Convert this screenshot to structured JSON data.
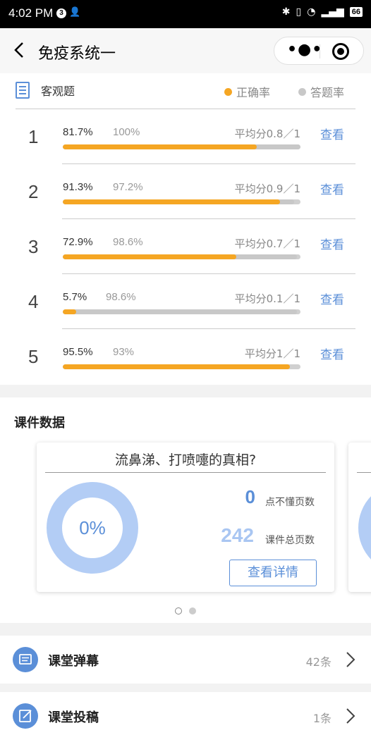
{
  "status_bar": {
    "time": "4:02 PM",
    "badge": "3",
    "battery": "66"
  },
  "nav": {
    "title": "免疫系统一"
  },
  "objective": {
    "title": "客观题",
    "legend": [
      {
        "label": "正确率",
        "color": "#f5a623"
      },
      {
        "label": "答题率",
        "color": "#c8c8c8"
      }
    ],
    "view_label": "查看",
    "questions": [
      {
        "num": "1",
        "correct": "81.7%",
        "rate": "100%",
        "avg": "平均分0.8／1",
        "correct_value": 81.7,
        "rate_value": 100
      },
      {
        "num": "2",
        "correct": "91.3%",
        "rate": "97.2%",
        "avg": "平均分0.9／1",
        "correct_value": 91.3,
        "rate_value": 97.2
      },
      {
        "num": "3",
        "correct": "72.9%",
        "rate": "98.6%",
        "avg": "平均分0.7／1",
        "correct_value": 72.9,
        "rate_value": 98.6
      },
      {
        "num": "4",
        "correct": "5.7%",
        "rate": "98.6%",
        "avg": "平均分0.1／1",
        "correct_value": 5.7,
        "rate_value": 98.6
      },
      {
        "num": "5",
        "correct": "95.5%",
        "rate": "93%",
        "avg": "平均分1／1",
        "correct_value": 95.5,
        "rate_value": 93
      }
    ]
  },
  "courseware": {
    "section_title": "课件数据",
    "card": {
      "title": "流鼻涕、打喷嚏的真相?",
      "percent": "0%",
      "confused_pages": "0",
      "confused_label": "点不懂页数",
      "total_pages": "242",
      "total_label": "课件总页数",
      "detail_button": "查看详情"
    },
    "pager": {
      "count": 2,
      "active": 0
    }
  },
  "list": [
    {
      "label": "课堂弹幕",
      "count": "42条",
      "icon": "barrage-icon"
    },
    {
      "label": "课堂投稿",
      "count": "1条",
      "icon": "submission-icon"
    }
  ],
  "colors": {
    "accent": "#5b8fd8",
    "correct": "#f5a623",
    "answer_rate": "#c8c8c8"
  }
}
